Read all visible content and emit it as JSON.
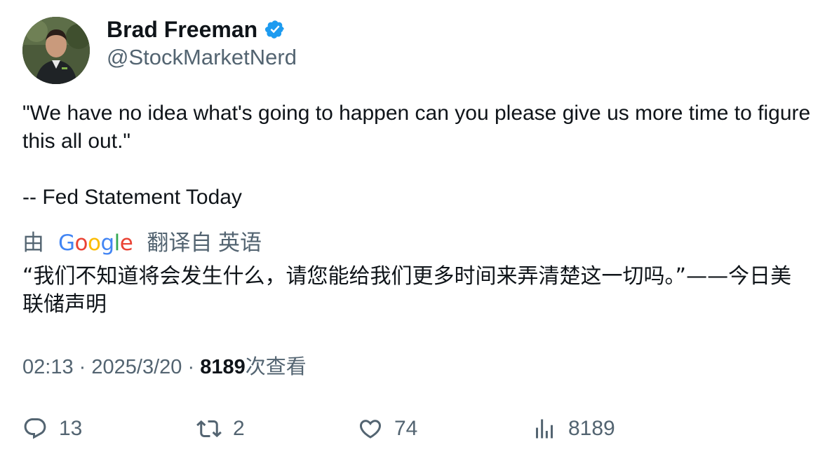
{
  "author": {
    "name": "Brad Freeman",
    "handle": "@StockMarketNerd",
    "verified": true
  },
  "tweet": {
    "text": "\"We have no idea what's going to happen can you please give us more time to figure this all out.\"\n\n-- Fed Statement Today",
    "translation_prefix": "由",
    "translation_provider": "Google",
    "translation_suffix": "翻译自 英语",
    "translated_text": "“我们不知道将会发生什么，请您能给我们更多时间来弄清楚这一切吗。”——今日美联储声明"
  },
  "meta": {
    "time": "02:13",
    "separator": "·",
    "date": "2025/3/20",
    "views_count": "8189",
    "views_label": "次查看"
  },
  "actions": {
    "replies": "13",
    "retweets": "2",
    "likes": "74",
    "views": "8189"
  },
  "colors": {
    "primary_text": "#0f1419",
    "secondary_text": "#536471",
    "verified_blue": "#1d9bf0"
  },
  "icons": {
    "verified": "verified-badge-icon",
    "reply": "reply-icon",
    "retweet": "retweet-icon",
    "like": "heart-icon",
    "views": "analytics-icon"
  }
}
